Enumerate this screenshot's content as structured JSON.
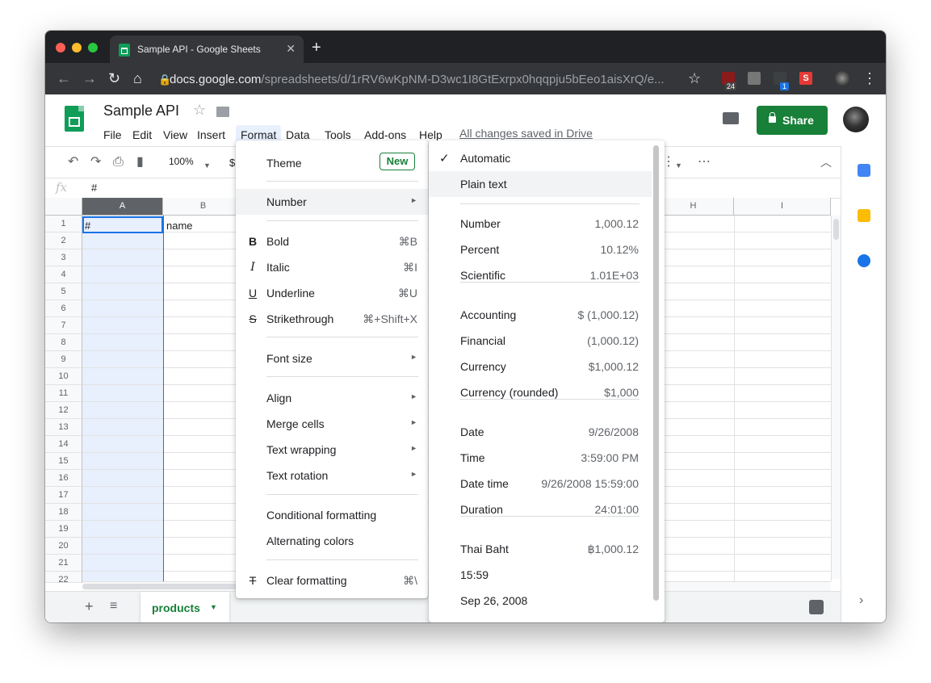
{
  "browser": {
    "tab_title": "Sample API - Google Sheets",
    "tab_close": "✕",
    "new_tab": "+",
    "url_host": "docs.google.com",
    "url_path": "/spreadsheets/d/1rRV6wKpNM-D3wc1I8GtExrpx0hqqpju5bEeo1aisXrQ/e...",
    "ext_badge_1": "24",
    "ext_badge_2": "1",
    "ext_s": "S",
    "colors": {
      "close": "#ff5f57",
      "minimize": "#febc2e",
      "maximize": "#28c840"
    }
  },
  "doc": {
    "title": "Sample API",
    "saved_status": "All changes saved in Drive",
    "share_label": "Share"
  },
  "menubar": [
    "File",
    "Edit",
    "View",
    "Insert",
    "Format",
    "Data",
    "Tools",
    "Add-ons",
    "Help"
  ],
  "toolbar": {
    "zoom": "100%",
    "currency": "$",
    "more": "⋯"
  },
  "formula_bar": {
    "fx": "fx",
    "value": "#"
  },
  "grid": {
    "columns": [
      "A",
      "B",
      "H",
      "I"
    ],
    "rows": [
      "1",
      "2",
      "3",
      "4",
      "5",
      "6",
      "7",
      "8",
      "9",
      "10",
      "11",
      "12",
      "13",
      "14",
      "15",
      "16",
      "17",
      "18",
      "19",
      "20",
      "21",
      "22"
    ],
    "cells": {
      "A1": "#",
      "B1": "name"
    }
  },
  "sheet_tab": {
    "name": "products"
  },
  "format_menu": {
    "theme": "Theme",
    "new_badge": "New",
    "number": "Number",
    "bold": "Bold",
    "bold_short": "⌘B",
    "italic": "Italic",
    "italic_short": "⌘I",
    "underline": "Underline",
    "underline_short": "⌘U",
    "strike": "Strikethrough",
    "strike_short": "⌘+Shift+X",
    "font_size": "Font size",
    "align": "Align",
    "merge": "Merge cells",
    "wrap": "Text wrapping",
    "rotation": "Text rotation",
    "conditional": "Conditional formatting",
    "alternating": "Alternating colors",
    "clear": "Clear formatting",
    "clear_short": "⌘\\",
    "icons": {
      "bold": "B",
      "italic": "I",
      "underline": "U",
      "strike": "S",
      "clear": "T"
    }
  },
  "number_menu": {
    "automatic": "Automatic",
    "plain_text": "Plain text",
    "items": [
      {
        "label": "Number",
        "value": "1,000.12"
      },
      {
        "label": "Percent",
        "value": "10.12%"
      },
      {
        "label": "Scientific",
        "value": "1.01E+03"
      },
      {
        "label": "Accounting",
        "value": "$ (1,000.12)"
      },
      {
        "label": "Financial",
        "value": "(1,000.12)"
      },
      {
        "label": "Currency",
        "value": "$1,000.12"
      },
      {
        "label": "Currency (rounded)",
        "value": "$1,000"
      },
      {
        "label": "Date",
        "value": "9/26/2008"
      },
      {
        "label": "Time",
        "value": "3:59:00 PM"
      },
      {
        "label": "Date time",
        "value": "9/26/2008 15:59:00"
      },
      {
        "label": "Duration",
        "value": "24:01:00"
      },
      {
        "label": "Thai Baht",
        "value": "฿1,000.12"
      },
      {
        "label": "15:59",
        "value": ""
      },
      {
        "label": "Sep 26, 2008",
        "value": ""
      }
    ]
  }
}
